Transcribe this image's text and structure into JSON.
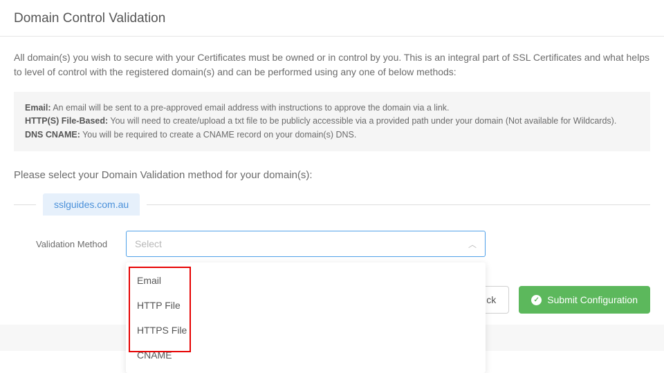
{
  "header": {
    "title": "Domain Control Validation"
  },
  "intro": {
    "text": "All domain(s) you wish to secure with your Certificates must be owned or in control by you. This is an integral part of SSL Certificates and what helps to level of control with the registered domain(s) and can be performed using any one of below methods:"
  },
  "methods": {
    "email": {
      "label": "Email:",
      "desc": "An email will be sent to a pre-approved email address with instructions to approve the domain via a link."
    },
    "http": {
      "label": "HTTP(S) File-Based:",
      "desc": "You will need to create/upload a txt file to be publicly accessible via a provided path under your domain (Not available for Wildcards)."
    },
    "dns": {
      "label": "DNS CNAME:",
      "desc": "You will be required to create a CNAME record on your domain(s) DNS."
    }
  },
  "select_prompt": "Please select your Domain Validation method for your domain(s):",
  "domain": {
    "name": "sslguides.com.au"
  },
  "form": {
    "validation_label": "Validation Method",
    "select_placeholder": "Select"
  },
  "dropdown": {
    "options": [
      "Email",
      "HTTP File",
      "HTTPS File",
      "CNAME"
    ]
  },
  "buttons": {
    "back": "ck",
    "submit": "Submit Configuration"
  }
}
